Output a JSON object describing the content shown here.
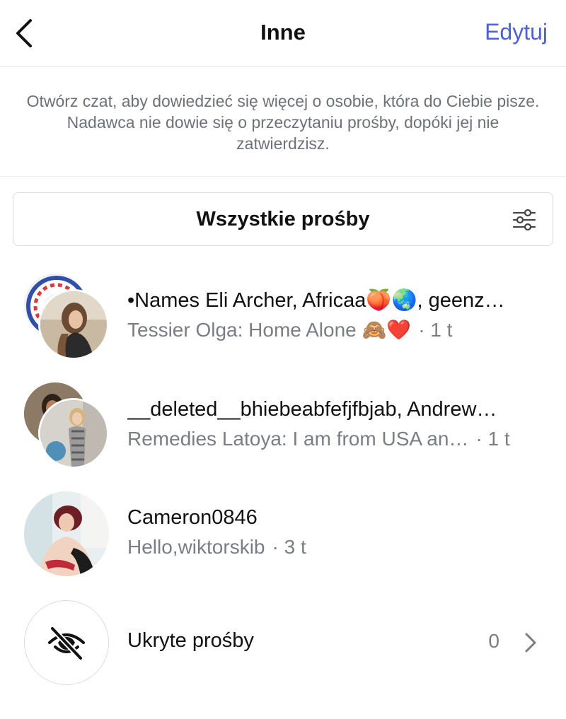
{
  "header": {
    "back_icon": "chevron-left-icon",
    "title": "Inne",
    "edit_label": "Edytuj",
    "accent_color": "#4f5fd8"
  },
  "info": {
    "text": "Otwórz czat, aby dowiedzieć się więcej o osobie, która do Ciebie pisze. Nadawca nie dowie się o przeczytaniu prośby, dopóki jej nie zatwierdzisz."
  },
  "filter": {
    "label": "Wszystkie prośby",
    "icon": "sliders-icon"
  },
  "requests": [
    {
      "name": "•Names Eli Archer, Africaa🍑🌏, geenz…",
      "preview": "Tessier Olga: Home Alone 🙈❤️",
      "time": "· 1 t"
    },
    {
      "name": "__deleted__bhiebeabfefjfbjab, Andrew…",
      "preview": "Remedies Latoya: I am from USA an…",
      "time": "· 1 t"
    },
    {
      "name": "Cameron0846",
      "preview": "Hello,wiktorskib",
      "time": "· 3 t"
    }
  ],
  "hidden": {
    "icon": "eye-slash-icon",
    "label": "Ukryte prośby",
    "count": "0",
    "chevron": "chevron-right-icon"
  }
}
